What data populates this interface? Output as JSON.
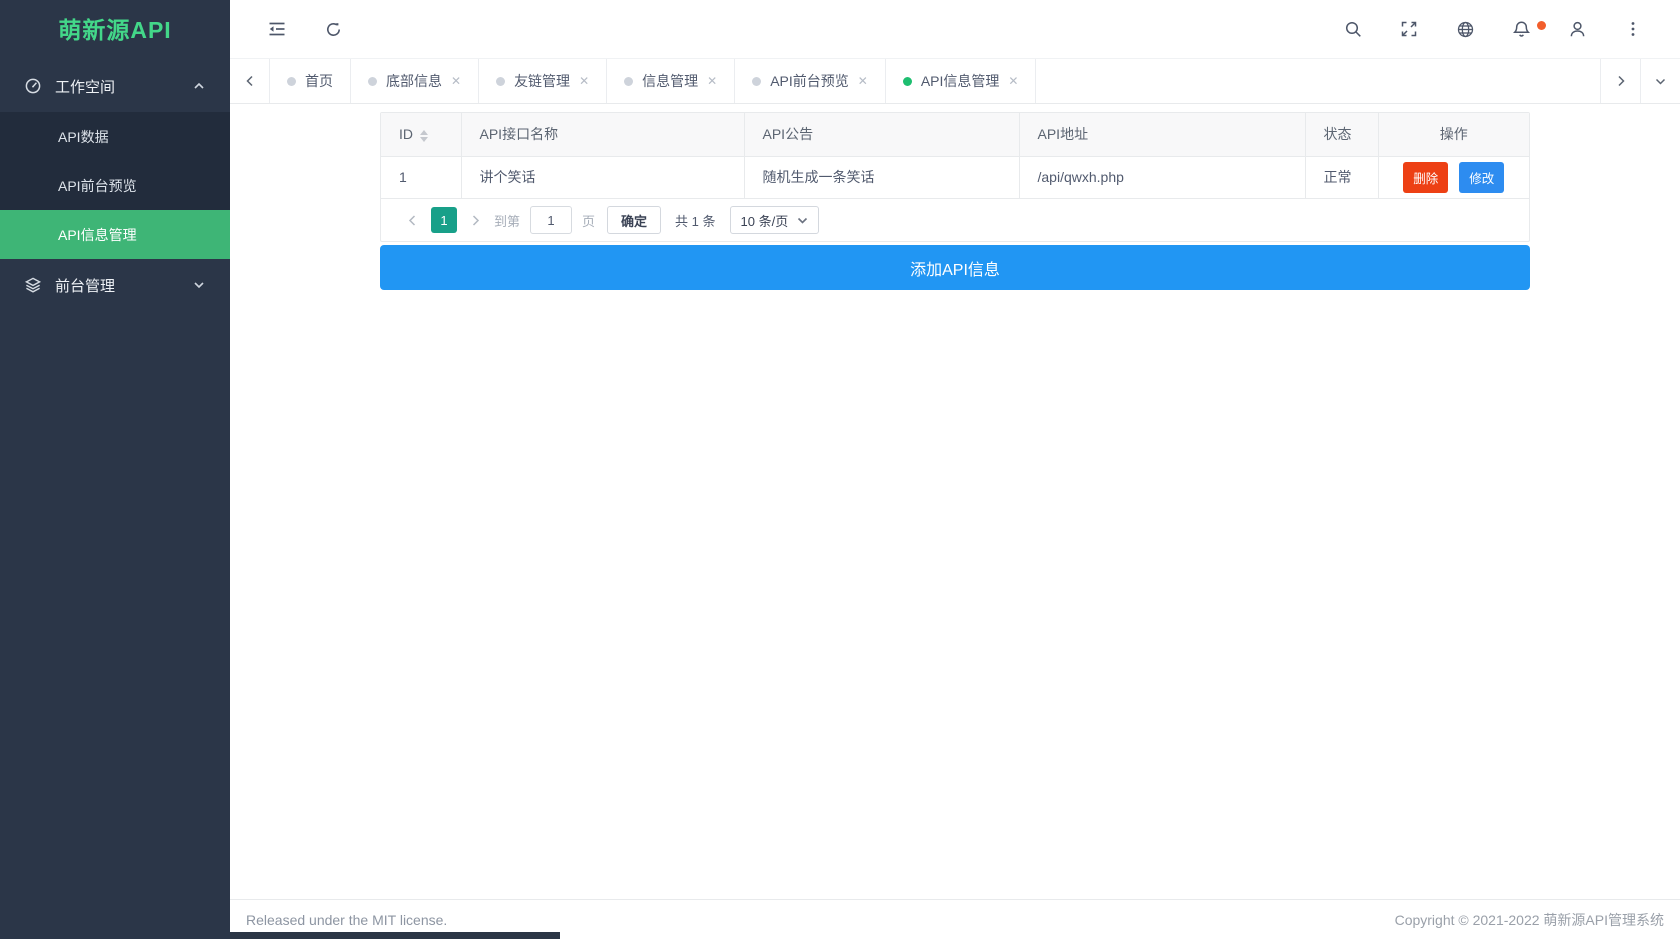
{
  "logo": "萌新源API",
  "sidebar": {
    "workspace": {
      "label": "工作空间"
    },
    "workspace_items": [
      {
        "label": "API数据"
      },
      {
        "label": "API前台预览"
      },
      {
        "label": "API信息管理"
      }
    ],
    "frontend": {
      "label": "前台管理"
    }
  },
  "tabs": [
    {
      "label": "首页"
    },
    {
      "label": "底部信息"
    },
    {
      "label": "友链管理"
    },
    {
      "label": "信息管理"
    },
    {
      "label": "API前台预览"
    },
    {
      "label": "API信息管理"
    }
  ],
  "table": {
    "headers": [
      "ID",
      "API接口名称",
      "API公告",
      "API地址",
      "状态",
      "操作"
    ],
    "rows": [
      {
        "id": "1",
        "name": "讲个笑话",
        "notice": "随机生成一条笑话",
        "address": "/api/qwxh.php",
        "status": "正常",
        "delete_label": "删除",
        "edit_label": "修改"
      }
    ]
  },
  "pagination": {
    "current_page": "1",
    "goto_prefix": "到第",
    "goto_value": "1",
    "goto_suffix": "页",
    "confirm_label": "确定",
    "total_label": "共 1 条",
    "page_size": "10 条/页"
  },
  "add_button_label": "添加API信息",
  "footer": {
    "left": "Released under the MIT license.",
    "right": "Copyright © 2021-2022 萌新源API管理系统"
  },
  "colors": {
    "sidebar_bg": "#2b3648",
    "submenu_bg": "#222c3c",
    "active_menu_green": "#3eb576",
    "logo_green": "#43d789",
    "tab_active_dot_green": "#1ebe70",
    "add_button_blue": "#2196f3",
    "edit_blue": "#2d8cf0",
    "delete_red": "#ed4014",
    "pagination_active_teal": "#18a089",
    "notification_dot_orange": "#f25e2c"
  }
}
